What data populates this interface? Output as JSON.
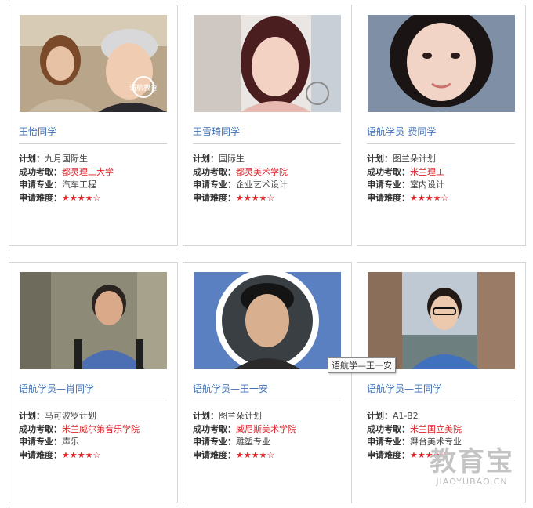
{
  "students": [
    {
      "name": "王怡同学",
      "plan_label": "计划：",
      "plan": "九月国际生",
      "school_label": "成功考取：",
      "school": "都灵理工大学",
      "major_label": "申请专业：",
      "major": "汽车工程",
      "difficulty_label": "申请难度：",
      "stars": "★★★★☆",
      "stamp": "语航教育"
    },
    {
      "name": "王雪琦同学",
      "plan_label": "计划：",
      "plan": "国际生",
      "school_label": "成功考取：",
      "school": "都灵美术学院",
      "major_label": "申请专业：",
      "major": "企业艺术设计",
      "difficulty_label": "申请难度：",
      "stars": "★★★★☆"
    },
    {
      "name": "语航学员-费同学",
      "plan_label": "计划：",
      "plan": "图兰朵计划",
      "school_label": "成功考取：",
      "school": "米兰理工",
      "major_label": "申请专业：",
      "major": "室内设计",
      "difficulty_label": "申请难度：",
      "stars": "★★★★☆"
    },
    {
      "name": "语航学员—肖同学",
      "plan_label": "计划：",
      "plan": "马可波罗计划",
      "school_label": "成功考取：",
      "school": "米兰威尔第音乐学院",
      "major_label": "申请专业：",
      "major": "声乐",
      "difficulty_label": "申请难度：",
      "stars": "★★★★☆"
    },
    {
      "name": "语航学员—王一安",
      "plan_label": "计划：",
      "plan": "图兰朵计划",
      "school_label": "成功考取：",
      "school": "威尼斯美术学院",
      "major_label": "申请专业：",
      "major": "雕塑专业",
      "difficulty_label": "申请难度：",
      "stars": "★★★★☆"
    },
    {
      "name": "语航学员—王同学",
      "plan_label": "计划：",
      "plan": "A1-B2",
      "school_label": "成功考取：",
      "school": "米兰国立美院",
      "major_label": "申请专业：",
      "major": "舞台美术专业",
      "difficulty_label": "申请难度：",
      "stars": "★★★★☆"
    }
  ],
  "tooltip": "语航学—王一安",
  "watermark": {
    "big": "教育宝",
    "small": "JIAOYUBAO.CN"
  }
}
